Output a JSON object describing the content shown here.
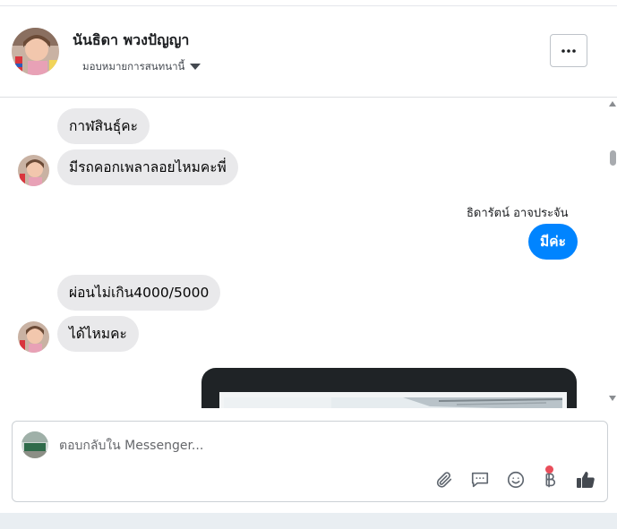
{
  "header": {
    "contact_name": "นันธิดา พวงปัญญา",
    "assign_label": "มอบหมายการสนทนานี้",
    "icons": {
      "assign_dropdown": "caret-down-icon",
      "more": "more-horizontal-icon"
    }
  },
  "messages": [
    {
      "direction": "incoming",
      "text": "กาฬสินธุ์คะ"
    },
    {
      "direction": "incoming",
      "text": "มีรถคอกเพลาลอยไหมคะพี่"
    },
    {
      "direction": "outgoing",
      "sender": "ธิดารัตน์ อาจประจัน",
      "text": "มีค่ะ"
    },
    {
      "direction": "incoming",
      "text": "ผ่อนไม่เกิน4000/5000"
    },
    {
      "direction": "incoming",
      "text": "ได้ไหมคะ"
    },
    {
      "direction": "outgoing",
      "type": "image"
    }
  ],
  "composer": {
    "placeholder": "ตอบกลับใน Messenger...",
    "value": "",
    "tools": [
      "paperclip-icon",
      "message-template-icon",
      "emoji-icon",
      "baht-payment-icon",
      "thumbs-up-icon"
    ]
  },
  "colors": {
    "outgoing_bubble": "#0084ff",
    "incoming_bubble": "#e9e9eb",
    "notification_dot": "#e94d5a",
    "border": "#ccd0d5"
  }
}
